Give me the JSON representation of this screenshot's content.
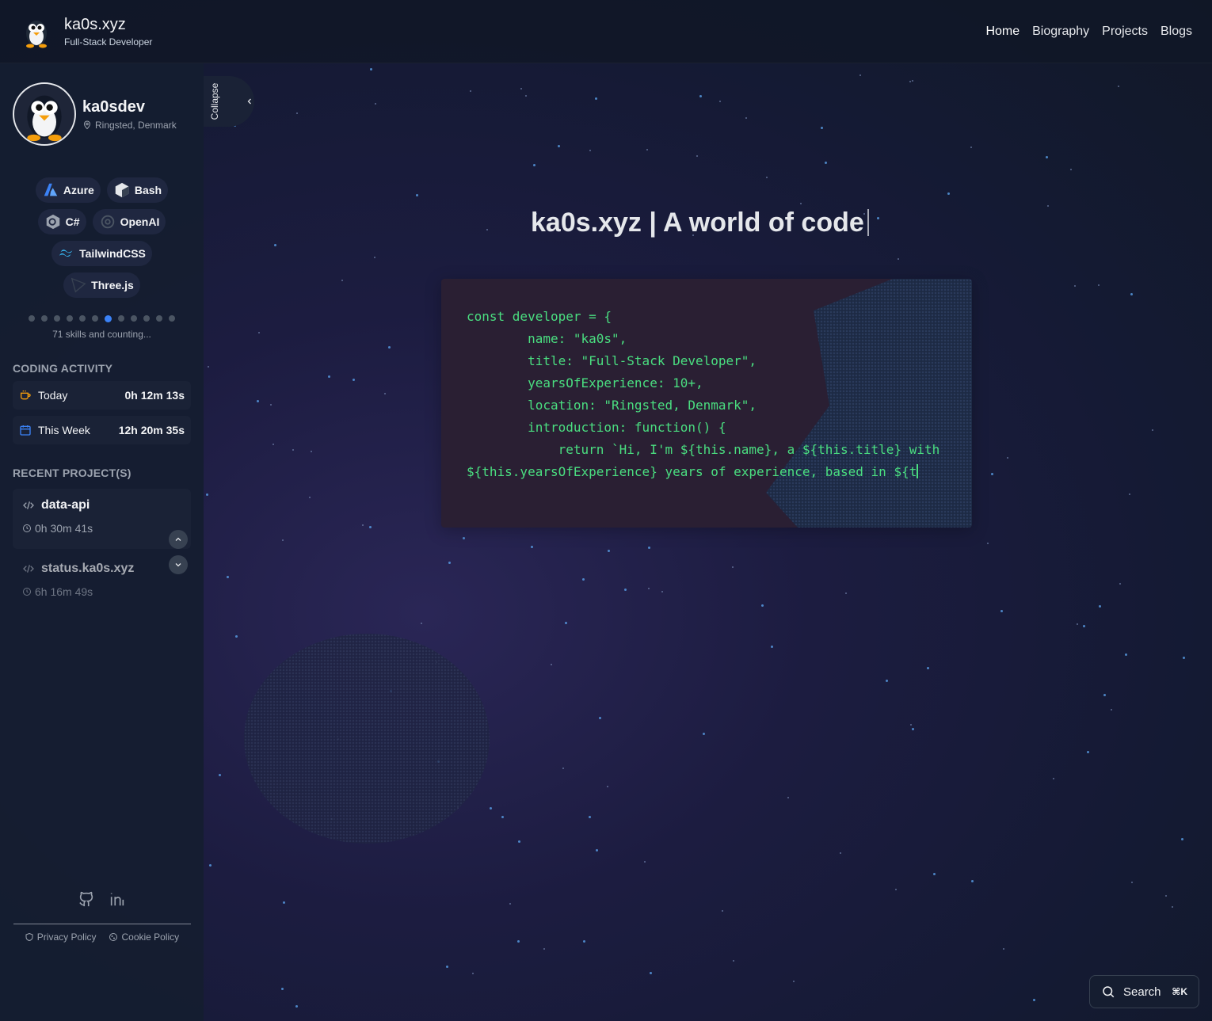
{
  "brand": {
    "title": "ka0s.xyz",
    "subtitle": "Full-Stack Developer"
  },
  "nav": {
    "items": [
      "Home",
      "Biography",
      "Projects",
      "Blogs"
    ],
    "active": "Home"
  },
  "profile": {
    "name": "ka0sdev",
    "location": "Ringsted, Denmark"
  },
  "skills": {
    "rows": [
      [
        {
          "label": "Azure",
          "icon": "azure-icon"
        },
        {
          "label": "Bash",
          "icon": "bash-icon"
        }
      ],
      [
        {
          "label": "C#",
          "icon": "csharp-icon"
        },
        {
          "label": "OpenAI",
          "icon": "openai-icon"
        }
      ],
      [
        {
          "label": "TailwindCSS",
          "icon": "tailwind-icon"
        }
      ],
      [
        {
          "label": "Three.js",
          "icon": "threejs-icon"
        }
      ]
    ],
    "dot_count": 12,
    "active_dot": 6,
    "count_text": "71 skills and counting..."
  },
  "coding_activity": {
    "title": "CODING ACTIVITY",
    "today_label": "Today",
    "today_value": "0h 12m 13s",
    "week_label": "This Week",
    "week_value": "12h 20m 35s"
  },
  "recent_projects": {
    "title": "RECENT PROJECT(S)",
    "items": [
      {
        "name": "data-api",
        "time": "0h 30m 41s"
      },
      {
        "name": "status.ka0s.xyz",
        "time": "6h 16m 49s"
      }
    ]
  },
  "footer": {
    "privacy": "Privacy Policy",
    "cookie": "Cookie Policy"
  },
  "collapse": {
    "label": "Collapse"
  },
  "hero": {
    "title": "ka0s.xyz | A world of code"
  },
  "code": {
    "text": "const developer = {\n        name: \"ka0s\",\n        title: \"Full-Stack Developer\",\n        yearsOfExperience: 10+,\n        location: \"Ringsted, Denmark\",\n        introduction: function() {\n            return `Hi, I'm ${this.name}, a ${this.title} with ${this.yearsOfExperience} years of experience, based in ${t"
  },
  "search": {
    "label": "Search",
    "shortcut": "⌘K"
  },
  "colors": {
    "accent": "#3b82f6",
    "code": "#4ade80",
    "sidebar": "#151d30"
  }
}
